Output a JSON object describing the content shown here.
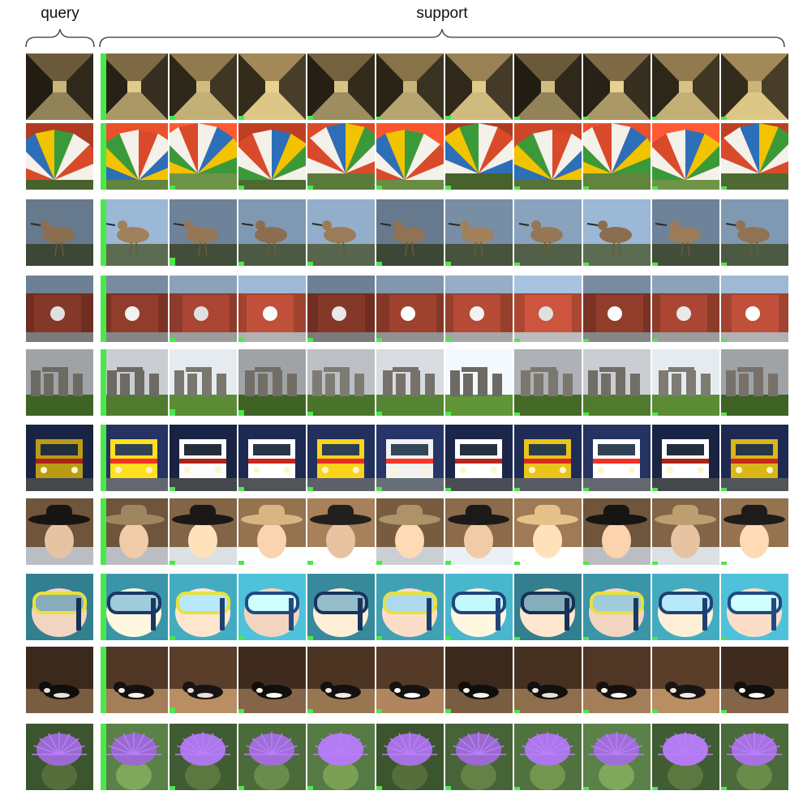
{
  "labels": {
    "query": "query",
    "support": "support"
  },
  "colors": {
    "similarity_bar": "#4be84b",
    "brace_stroke": "#555555"
  },
  "rows": [
    {
      "subject": "corridor",
      "palette": {
        "bg": "#6b5a3a",
        "accent": "#c9b57a",
        "dark": "#2a2418"
      },
      "scores": [
        1.0,
        0.06,
        0.06,
        0.06,
        0.05,
        0.06,
        0.05,
        0.05,
        0.05,
        0.05
      ]
    },
    {
      "subject": "parachute-canopy",
      "palette": {
        "bg": "#d94a2a",
        "accent": "#f4f0ea",
        "dark": "#2c6fb8"
      },
      "scores": [
        1.0,
        0.06,
        0.06,
        0.06,
        0.06,
        0.06,
        0.05,
        0.05,
        0.05,
        0.05
      ]
    },
    {
      "subject": "shorebird",
      "palette": {
        "bg": "#7f97b0",
        "accent": "#8b6e4f",
        "dark": "#3f4a38"
      },
      "scores": [
        1.0,
        0.12,
        0.06,
        0.06,
        0.06,
        0.06,
        0.05,
        0.05,
        0.05,
        0.05
      ]
    },
    {
      "subject": "red-machine",
      "palette": {
        "bg": "#8c3a2a",
        "accent": "#e0e0e0",
        "dark": "#1e1e1e"
      },
      "scores": [
        1.0,
        0.06,
        0.06,
        0.06,
        0.06,
        0.06,
        0.05,
        0.05,
        0.05,
        0.05
      ]
    },
    {
      "subject": "stonehenge",
      "palette": {
        "bg": "#c8ccd0",
        "accent": "#6d6a63",
        "dark": "#4f7a2e"
      },
      "scores": [
        1.0,
        0.1,
        0.08,
        0.06,
        0.06,
        0.06,
        0.05,
        0.05,
        0.05,
        0.05
      ]
    },
    {
      "subject": "emergency-truck",
      "palette": {
        "bg": "#1f2c55",
        "accent": "#f2f2f2",
        "dark": "#d62a1f"
      },
      "scores": [
        1.0,
        0.06,
        0.06,
        0.06,
        0.06,
        0.05,
        0.05,
        0.05,
        0.05,
        0.05
      ]
    },
    {
      "subject": "cowboy-hat-portrait",
      "palette": {
        "bg": "#8a6a4a",
        "accent": "#e8c3a2",
        "dark": "#1c1a18"
      },
      "scores": [
        1.0,
        0.06,
        0.06,
        0.06,
        0.06,
        0.06,
        0.05,
        0.05,
        0.05,
        0.05
      ]
    },
    {
      "subject": "snorkel-mask",
      "palette": {
        "bg": "#3f9fb3",
        "accent": "#f2d5c0",
        "dark": "#1d3c6a"
      },
      "scores": [
        1.0,
        0.06,
        0.06,
        0.06,
        0.06,
        0.06,
        0.05,
        0.05,
        0.05,
        0.05
      ]
    },
    {
      "subject": "dog-lying",
      "palette": {
        "bg": "#4a3322",
        "accent": "#e8e2d8",
        "dark": "#141010"
      },
      "scores": [
        1.0,
        0.08,
        0.06,
        0.06,
        0.06,
        0.06,
        0.05,
        0.05,
        0.05,
        0.05
      ]
    },
    {
      "subject": "artichoke-flower",
      "palette": {
        "bg": "#4a6a3a",
        "accent": "#9a6ad0",
        "dark": "#2a3a20"
      },
      "scores": [
        1.0,
        0.06,
        0.06,
        0.06,
        0.06,
        0.06,
        0.05,
        0.05,
        0.05,
        0.05
      ]
    }
  ]
}
